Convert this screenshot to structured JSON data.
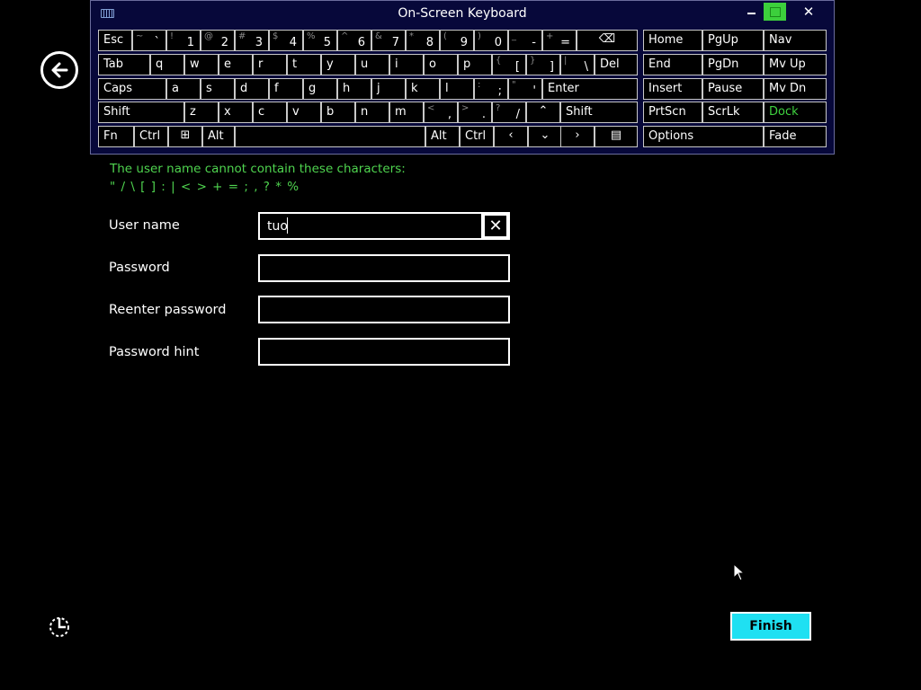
{
  "osk": {
    "title": "On-Screen Keyboard",
    "close": "✕",
    "rows": [
      [
        {
          "name": "key-esc",
          "label": "Esc"
        },
        {
          "name": "key-tilde",
          "sec": "~",
          "pri": "`"
        },
        {
          "name": "key-1",
          "sec": "!",
          "pri": "1"
        },
        {
          "name": "key-2",
          "sec": "@",
          "pri": "2"
        },
        {
          "name": "key-3",
          "sec": "#",
          "pri": "3"
        },
        {
          "name": "key-4",
          "sec": "$",
          "pri": "4"
        },
        {
          "name": "key-5",
          "sec": "%",
          "pri": "5"
        },
        {
          "name": "key-6",
          "sec": "^",
          "pri": "6"
        },
        {
          "name": "key-7",
          "sec": "&",
          "pri": "7"
        },
        {
          "name": "key-8",
          "sec": "*",
          "pri": "8"
        },
        {
          "name": "key-9",
          "sec": "(",
          "pri": "9"
        },
        {
          "name": "key-0",
          "sec": ")",
          "pri": "0"
        },
        {
          "name": "key-minus",
          "sec": "_",
          "pri": "-"
        },
        {
          "name": "key-equals",
          "sec": "+",
          "pri": "="
        },
        {
          "name": "key-backspace",
          "icon": "⌫"
        },
        {
          "name": "key-home",
          "label": "Home"
        },
        {
          "name": "key-pgup",
          "label": "PgUp"
        },
        {
          "name": "key-nav",
          "label": "Nav"
        }
      ],
      [
        {
          "name": "key-tab",
          "label": "Tab"
        },
        {
          "name": "key-q",
          "label": "q"
        },
        {
          "name": "key-w",
          "label": "w"
        },
        {
          "name": "key-e",
          "label": "e"
        },
        {
          "name": "key-r",
          "label": "r"
        },
        {
          "name": "key-t",
          "label": "t"
        },
        {
          "name": "key-y",
          "label": "y"
        },
        {
          "name": "key-u",
          "label": "u"
        },
        {
          "name": "key-i",
          "label": "i"
        },
        {
          "name": "key-o",
          "label": "o"
        },
        {
          "name": "key-p",
          "label": "p"
        },
        {
          "name": "key-lbracket",
          "sec": "{",
          "pri": "["
        },
        {
          "name": "key-rbracket",
          "sec": "}",
          "pri": "]"
        },
        {
          "name": "key-backslash",
          "sec": "|",
          "pri": "\\"
        },
        {
          "name": "key-del",
          "label": "Del"
        },
        {
          "name": "key-end",
          "label": "End"
        },
        {
          "name": "key-pgdn",
          "label": "PgDn"
        },
        {
          "name": "key-mvup",
          "label": "Mv Up"
        }
      ],
      [
        {
          "name": "key-caps",
          "label": "Caps"
        },
        {
          "name": "key-a",
          "label": "a"
        },
        {
          "name": "key-s",
          "label": "s"
        },
        {
          "name": "key-d",
          "label": "d"
        },
        {
          "name": "key-f",
          "label": "f"
        },
        {
          "name": "key-g",
          "label": "g"
        },
        {
          "name": "key-h",
          "label": "h"
        },
        {
          "name": "key-j",
          "label": "j"
        },
        {
          "name": "key-k",
          "label": "k"
        },
        {
          "name": "key-l",
          "label": "l"
        },
        {
          "name": "key-semicolon",
          "sec": ":",
          "pri": ";"
        },
        {
          "name": "key-quote",
          "sec": "\"",
          "pri": "'"
        },
        {
          "name": "key-enter",
          "label": "Enter"
        },
        {
          "name": "key-insert",
          "label": "Insert"
        },
        {
          "name": "key-pause",
          "label": "Pause"
        },
        {
          "name": "key-mvdn",
          "label": "Mv Dn"
        }
      ],
      [
        {
          "name": "key-shift-left",
          "label": "Shift"
        },
        {
          "name": "key-z",
          "label": "z"
        },
        {
          "name": "key-x",
          "label": "x"
        },
        {
          "name": "key-c",
          "label": "c"
        },
        {
          "name": "key-v",
          "label": "v"
        },
        {
          "name": "key-b",
          "label": "b"
        },
        {
          "name": "key-n",
          "label": "n"
        },
        {
          "name": "key-m",
          "label": "m"
        },
        {
          "name": "key-comma",
          "sec": "<",
          "pri": ","
        },
        {
          "name": "key-period",
          "sec": ">",
          "pri": "."
        },
        {
          "name": "key-slash",
          "sec": "?",
          "pri": "/"
        },
        {
          "name": "key-up",
          "icon": "⌃"
        },
        {
          "name": "key-shift-right",
          "label": "Shift"
        },
        {
          "name": "key-prtscn",
          "label": "PrtScn"
        },
        {
          "name": "key-scrlk",
          "label": "ScrLk"
        },
        {
          "name": "key-dock",
          "label": "Dock",
          "green": true
        }
      ],
      [
        {
          "name": "key-fn",
          "label": "Fn"
        },
        {
          "name": "key-ctrl-left",
          "label": "Ctrl"
        },
        {
          "name": "key-windows",
          "icon": "⊞"
        },
        {
          "name": "key-alt-left",
          "label": "Alt"
        },
        {
          "name": "key-space",
          "label": ""
        },
        {
          "name": "key-alt-right",
          "label": "Alt"
        },
        {
          "name": "key-ctrl-right",
          "label": "Ctrl"
        },
        {
          "name": "key-left",
          "icon": "‹"
        },
        {
          "name": "key-down",
          "icon": "⌄"
        },
        {
          "name": "key-right",
          "icon": "›"
        },
        {
          "name": "key-menu",
          "icon": "▤"
        },
        {
          "name": "key-options",
          "label": "Options"
        },
        {
          "name": "key-fade",
          "label": "Fade"
        }
      ]
    ]
  },
  "form": {
    "warning_title": "The user name cannot contain these characters:",
    "warning_chars": "\" / \\ [ ] : | < > + = ; , ? * %",
    "username_label": "User name",
    "username_value": "tuo",
    "password_label": "Password",
    "reenter_label": "Reenter password",
    "hint_label": "Password hint",
    "clear_icon": "✕"
  },
  "finish_label": "Finish",
  "colors": {
    "accent": "#1fe0f2",
    "warning": "#4fd44f",
    "keyboard_bg": "#07083a",
    "dock_green": "#3fd23f"
  },
  "icons": [
    "back-arrow-icon",
    "ease-of-access-icon",
    "keyboard-icon",
    "backspace-icon",
    "windows-icon",
    "mouse-pointer-icon"
  ]
}
